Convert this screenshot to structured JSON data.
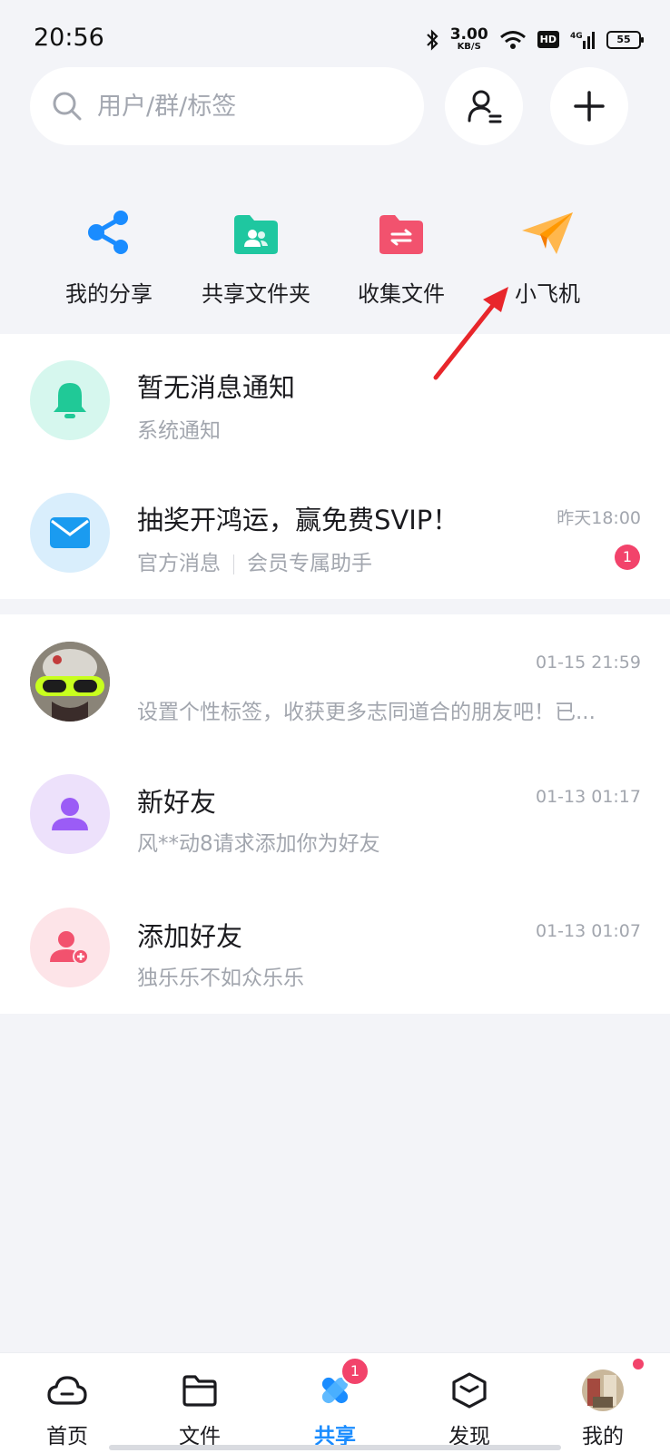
{
  "status_bar": {
    "time": "20:56",
    "net_speed_value": "3.00",
    "net_speed_unit": "KB/S",
    "hd_label": "HD",
    "net_type": "4G",
    "battery": "55"
  },
  "search": {
    "placeholder": "用户/群/标签"
  },
  "quick_actions": [
    {
      "label": "我的分享",
      "icon": "share-icon",
      "color": "#1a8cff"
    },
    {
      "label": "共享文件夹",
      "icon": "shared-folder-icon",
      "color": "#1fc7a0"
    },
    {
      "label": "收集文件",
      "icon": "collect-folder-icon",
      "color": "#f2526e"
    },
    {
      "label": "小飞机",
      "icon": "paper-plane-icon",
      "color": "#ffa726"
    }
  ],
  "notifications": [
    {
      "title": "暂无消息通知",
      "subtitle": "系统通知",
      "icon": "bell-icon"
    },
    {
      "title": "抽奖开鸿运，赢免费SVIP！",
      "subtitle_a": "官方消息",
      "subtitle_b": "会员专属助手",
      "time": "昨天18:00",
      "badge": "1",
      "icon": "mail-icon"
    }
  ],
  "messages": [
    {
      "title": "",
      "subtitle": "设置个性标签，收获更多志同道合的朋友吧！已...",
      "time": "01-15 21:59",
      "icon": "user-avatar"
    },
    {
      "title": "新好友",
      "subtitle": "风**动8请求添加你为好友",
      "time": "01-13 01:17",
      "icon": "person-icon"
    },
    {
      "title": "添加好友",
      "subtitle": "独乐乐不如众乐乐",
      "time": "01-13 01:07",
      "icon": "add-person-icon"
    }
  ],
  "tabs": [
    {
      "label": "首页",
      "icon": "cloud-icon"
    },
    {
      "label": "文件",
      "icon": "folder-icon"
    },
    {
      "label": "共享",
      "icon": "share-x-icon",
      "badge": "1",
      "active": true
    },
    {
      "label": "发现",
      "icon": "cube-icon"
    },
    {
      "label": "我的",
      "icon": "profile-avatar"
    }
  ],
  "colors": {
    "accent": "#1a8cff",
    "badge": "#f2436b",
    "background": "#f3f4f8"
  }
}
